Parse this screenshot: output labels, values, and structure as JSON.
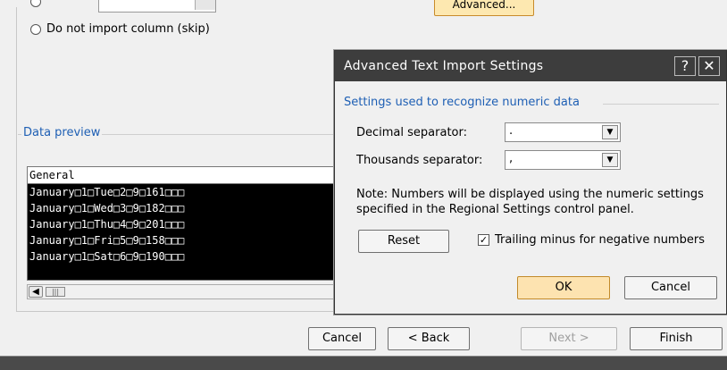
{
  "wizard": {
    "radio_skip_label": "Do not import column (skip)",
    "advanced_label": "Advanced...",
    "preview_title": "Data preview",
    "preview_header": "General",
    "preview_rows": [
      "January□1□Tue□2□9□161□□□",
      "January□1□Wed□3□9□182□□□",
      "January□1□Thu□4□9□201□□□",
      "January□1□Fri□5□9□158□□□",
      "January□1□Sat□6□9□190□□□"
    ],
    "scroll_left_icon": "left-arrow-icon",
    "buttons": {
      "cancel": "Cancel",
      "back": "< Back",
      "next": "Next >",
      "finish": "Finish"
    }
  },
  "dialog": {
    "title": "Advanced Text Import Settings",
    "help_label": "?",
    "close_label": "✕",
    "group_title": "Settings used to recognize numeric data",
    "decimal_label": "Decimal separator:",
    "decimal_value": ".",
    "thousands_label": "Thousands separator:",
    "thousands_value": ",",
    "note": "Note: Numbers will be displayed using the numeric settings specified in the Regional Settings control panel.",
    "reset_label": "Reset",
    "trailing_minus_label": "Trailing minus for negative numbers",
    "trailing_minus_checked": true,
    "ok_label": "OK",
    "cancel_label": "Cancel"
  },
  "colors": {
    "accent_blue": "#1e5fb4",
    "focus_orange": "#fde3b0",
    "titlebar": "#3d3d3d"
  }
}
